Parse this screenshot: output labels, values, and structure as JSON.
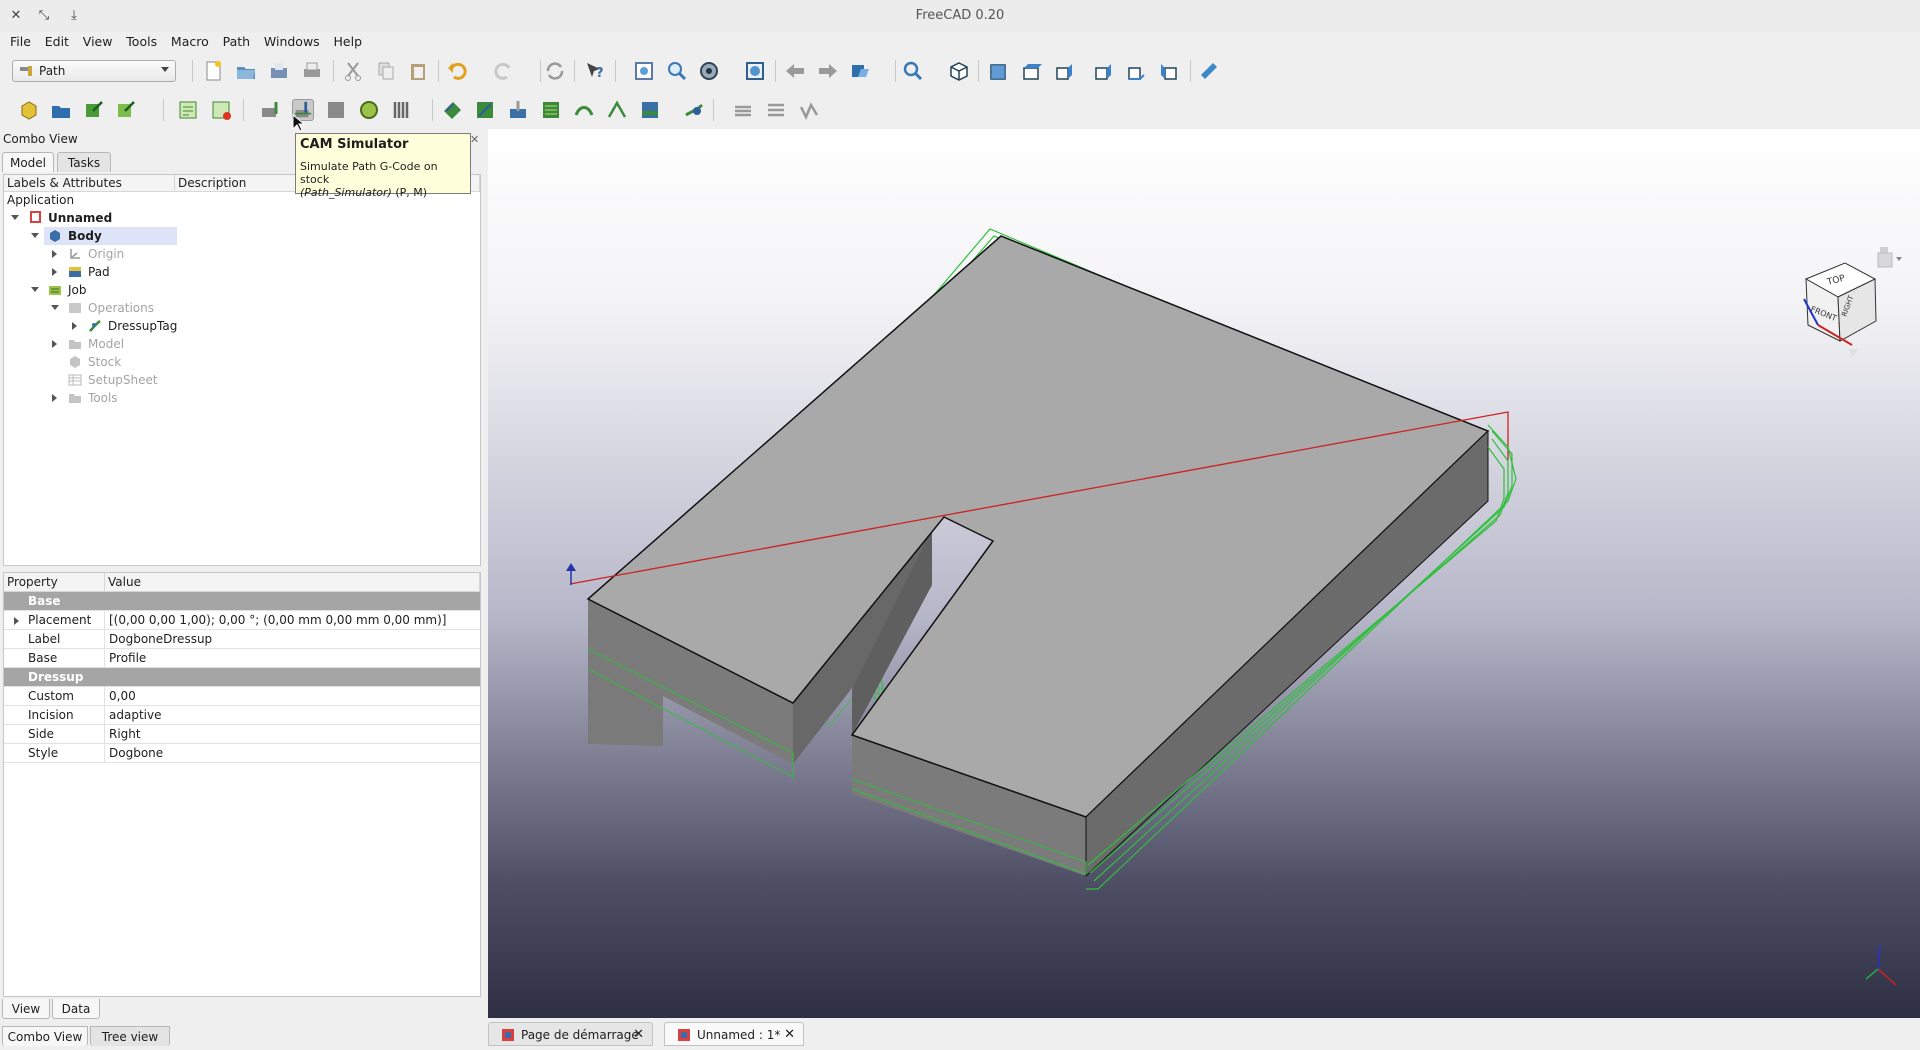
{
  "window": {
    "title": "FreeCAD 0.20"
  },
  "menu": [
    "File",
    "Edit",
    "View",
    "Tools",
    "Macro",
    "Path",
    "Windows",
    "Help"
  ],
  "workbench": {
    "label": "Path"
  },
  "combo_view": {
    "title": "Combo View",
    "tabs": [
      "Model",
      "Tasks"
    ],
    "columns": [
      "Labels & Attributes",
      "Description"
    ],
    "tree": {
      "application": "Application",
      "unnamed": "Unnamed",
      "body": "Body",
      "origin": "Origin",
      "pad": "Pad",
      "job": "Job",
      "operations": "Operations",
      "dressup_tag": "DressupTag",
      "model": "Model",
      "stock": "Stock",
      "setup_sheet": "SetupSheet",
      "tools": "Tools"
    }
  },
  "properties": {
    "columns": [
      "Property",
      "Value"
    ],
    "groups": {
      "base": "Base",
      "dressup": "Dressup"
    },
    "rows": {
      "placement": {
        "k": "Placement",
        "v": "[(0,00 0,00 1,00); 0,00 °; (0,00 mm  0,00 mm  0,00 mm)]"
      },
      "label": {
        "k": "Label",
        "v": "DogboneDressup"
      },
      "base": {
        "k": "Base",
        "v": "Profile"
      },
      "custom": {
        "k": "Custom",
        "v": "0,00"
      },
      "incision": {
        "k": "Incision",
        "v": "adaptive"
      },
      "side": {
        "k": "Side",
        "v": "Right"
      },
      "style": {
        "k": "Style",
        "v": "Dogbone"
      }
    },
    "bottom_tabs": [
      "View",
      "Data"
    ]
  },
  "panel_tabs": [
    "Combo View",
    "Tree view"
  ],
  "tooltip": {
    "title": "CAM Simulator",
    "line1": "Simulate Path G-Code on stock",
    "line2": "(Path_Simulator)",
    "shortcut": " (P, M)"
  },
  "nav_cube": {
    "top": "TOP",
    "front": "FRONT",
    "right": "RIGHT"
  },
  "doc_tabs": [
    "Page de démarrage",
    "Unnamed : 1*"
  ],
  "colors": {
    "toolpath": "#2fbf3c",
    "rapid": "#cc2222",
    "solid_top": "#a9a9a9",
    "solid_side": "#6d6d6d",
    "tree_selection": "#dde4f7",
    "tooltip_bg": "#ffffdc"
  }
}
